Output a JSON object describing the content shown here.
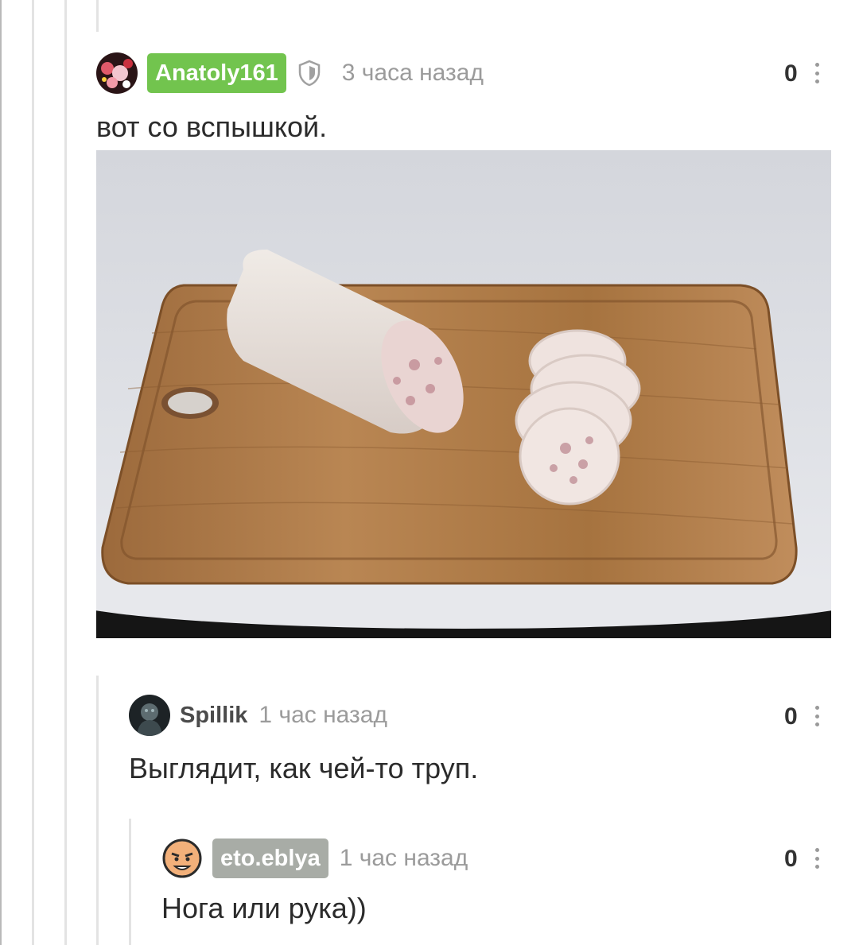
{
  "comments": [
    {
      "username": "Anatoly161",
      "time": "3 часа назад",
      "rating": "0",
      "text": "вот со вспышкой.",
      "badge_color": "#72c44e"
    },
    {
      "username": "Spillik",
      "time": "1 час назад",
      "rating": "0",
      "text": "Выглядит, как чей-то труп."
    },
    {
      "username": "eto.eblya",
      "time": "1 час назад",
      "rating": "0",
      "text": "Нога или рука))",
      "badge_color": "#a8aca6"
    }
  ],
  "icons": [
    "shield-icon",
    "more-icon"
  ],
  "colors": {
    "time": "#9b9b9b",
    "thread_line": "#e3e3e3"
  }
}
